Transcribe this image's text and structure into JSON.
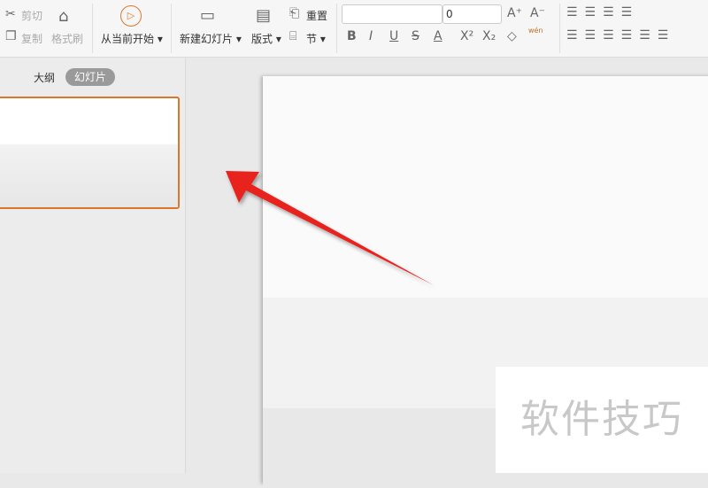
{
  "ribbon": {
    "cut": "剪切",
    "copy": "复制",
    "format_painter": "格式刷",
    "play_from_current": "从当前开始",
    "new_slide": "新建幻灯片",
    "layout": "版式",
    "reset": "重置",
    "section": "节",
    "font_name": "",
    "font_size": "0",
    "format_buttons": [
      "B",
      "I",
      "U",
      "S",
      "A"
    ],
    "phonetic": "wén"
  },
  "panel": {
    "tabs": [
      "大纲",
      "幻灯片"
    ],
    "active_tab": "幻灯片"
  },
  "watermark": "软件技巧",
  "colors": {
    "accent": "#d9782d",
    "arrow": "#e8201e"
  }
}
